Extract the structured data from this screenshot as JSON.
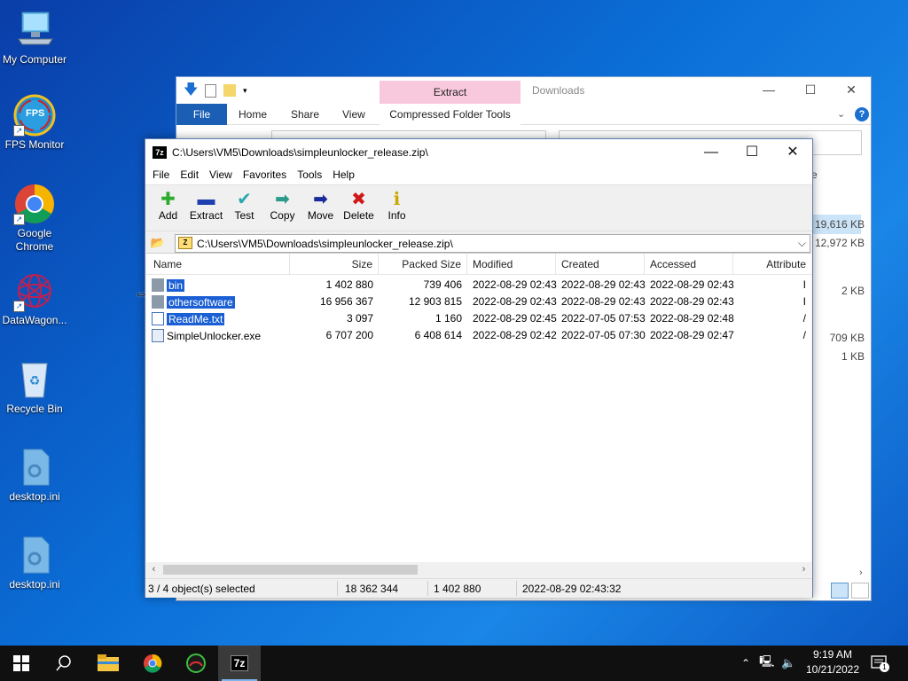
{
  "desktop": {
    "icons": [
      {
        "label": "My Computer"
      },
      {
        "label": "FPS Monitor",
        "badge": "FPS"
      },
      {
        "label": "Google Chrome"
      },
      {
        "label": "DataWagon..."
      },
      {
        "label": "Recycle Bin"
      },
      {
        "label": "desktop.ini"
      },
      {
        "label": "desktop.ini"
      }
    ]
  },
  "explorer": {
    "title": "Downloads",
    "contextual_tab": "Extract",
    "tabs": {
      "file": "File",
      "home": "Home",
      "share": "Share",
      "view": "View",
      "compressed": "Compressed Folder Tools"
    },
    "sizes": [
      "19,616 KB",
      "12,972 KB",
      "2 KB",
      "709 KB",
      "1 KB"
    ],
    "partial_text": "e"
  },
  "zip": {
    "title": "C:\\Users\\VM5\\Downloads\\simpleunlocker_release.zip\\",
    "app_icon": "7z",
    "menu": [
      "File",
      "Edit",
      "View",
      "Favorites",
      "Tools",
      "Help"
    ],
    "toolbar": [
      {
        "label": "Add",
        "icon": "plus-icon",
        "glyph": "✚",
        "color": "#2eaa2e"
      },
      {
        "label": "Extract",
        "icon": "minus-icon",
        "glyph": "▬",
        "color": "#1f3fb0"
      },
      {
        "label": "Test",
        "icon": "check-icon",
        "glyph": "✔",
        "color": "#2aa8b0"
      },
      {
        "label": "Copy",
        "icon": "copy-arrow-icon",
        "glyph": "➡",
        "color": "#2a9a8a"
      },
      {
        "label": "Move",
        "icon": "move-arrow-icon",
        "glyph": "➡",
        "color": "#1a2a9a"
      },
      {
        "label": "Delete",
        "icon": "delete-x-icon",
        "glyph": "✖",
        "color": "#d01818"
      },
      {
        "label": "Info",
        "icon": "info-icon",
        "glyph": "ℹ",
        "color": "#c8a800"
      }
    ],
    "path": "C:\\Users\\VM5\\Downloads\\simpleunlocker_release.zip\\",
    "columns": [
      "Name",
      "Size",
      "Packed Size",
      "Modified",
      "Created",
      "Accessed",
      "Attribute"
    ],
    "rows": [
      {
        "name": "bin",
        "type": "folder",
        "size": "1 402 880",
        "packed": "739 406",
        "modified": "2022-08-29 02:43",
        "created": "2022-08-29 02:43",
        "accessed": "2022-08-29 02:43",
        "attr": "I",
        "selected": true
      },
      {
        "name": "othersoftware",
        "type": "folder",
        "size": "16 956 367",
        "packed": "12 903 815",
        "modified": "2022-08-29 02:43",
        "created": "2022-08-29 02:43",
        "accessed": "2022-08-29 02:43",
        "attr": "I",
        "selected": true
      },
      {
        "name": "ReadMe.txt",
        "type": "txt",
        "size": "3 097",
        "packed": "1 160",
        "modified": "2022-08-29 02:45",
        "created": "2022-07-05 07:53",
        "accessed": "2022-08-29 02:48",
        "attr": "/",
        "selected": true
      },
      {
        "name": "SimpleUnlocker.exe",
        "type": "exe",
        "size": "6 707 200",
        "packed": "6 408 614",
        "modified": "2022-08-29 02:42",
        "created": "2022-07-05 07:30",
        "accessed": "2022-08-29 02:47",
        "attr": "/",
        "selected": false
      }
    ],
    "status": {
      "selection": "3 / 4 object(s) selected",
      "size": "18 362 344",
      "packed": "1 402 880",
      "modified": "2022-08-29 02:43:32"
    }
  },
  "taskbar": {
    "time": "9:19 AM",
    "date": "10/21/2022",
    "notification_count": "1",
    "active_app_label": "7z"
  }
}
